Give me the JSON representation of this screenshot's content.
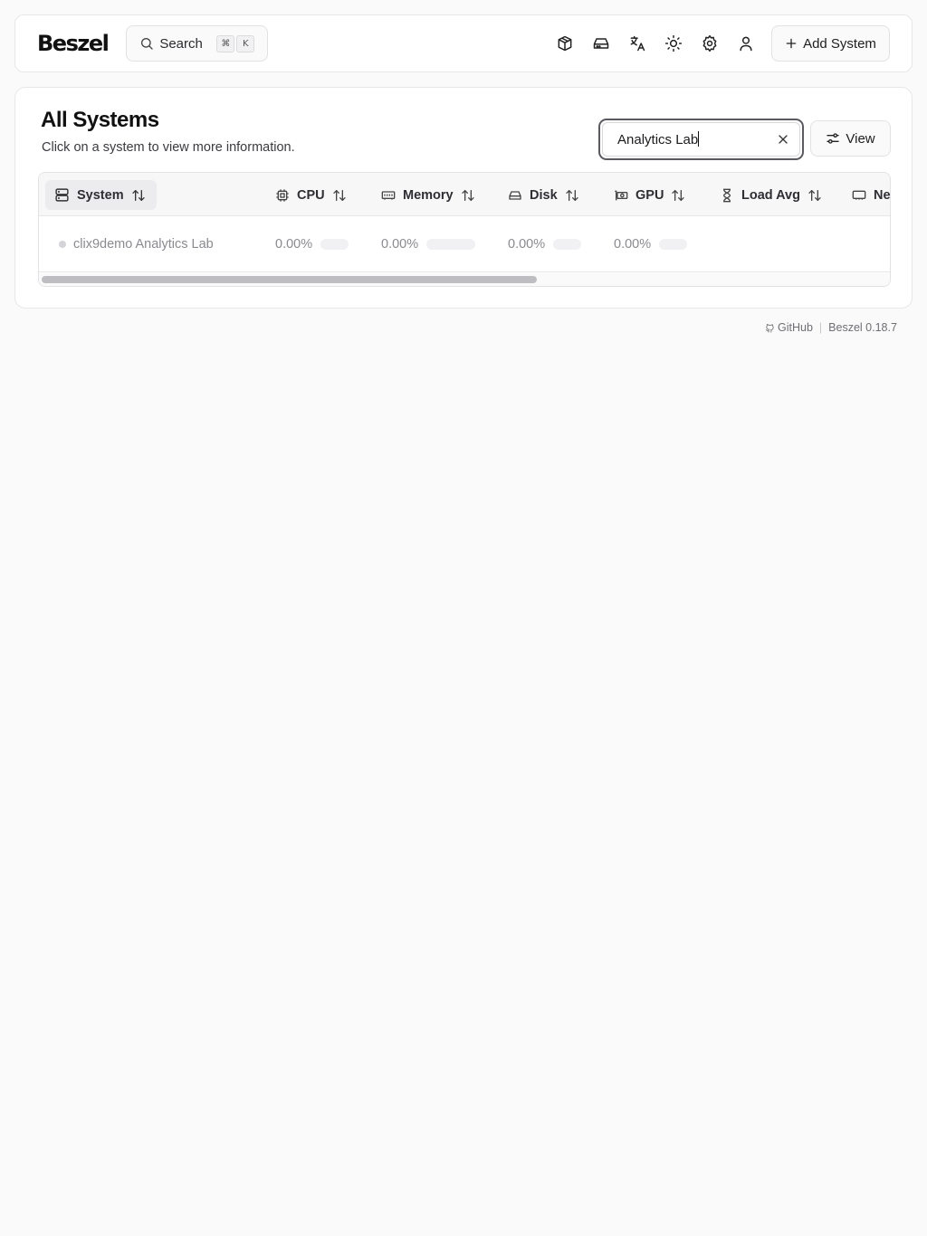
{
  "header": {
    "logo": "Beszel",
    "search_label": "Search",
    "search_shortcut": [
      "⌘",
      "K"
    ],
    "icons": [
      "containers-icon",
      "disks-icon",
      "language-icon",
      "theme-icon",
      "settings-icon",
      "user-icon"
    ],
    "add_system_label": "Add System"
  },
  "main": {
    "title": "All Systems",
    "subtitle": "Click on a system to view more information.",
    "filter_value": "Analytics Lab",
    "view_label": "View"
  },
  "table": {
    "columns": [
      {
        "label": "System",
        "icon": "server-icon"
      },
      {
        "label": "CPU",
        "icon": "cpu-icon"
      },
      {
        "label": "Memory",
        "icon": "memory-icon"
      },
      {
        "label": "Disk",
        "icon": "hard-drive-icon"
      },
      {
        "label": "GPU",
        "icon": "gpu-icon"
      },
      {
        "label": "Load Avg",
        "icon": "hourglass-icon"
      },
      {
        "label": "Ne",
        "icon": "network-icon"
      }
    ],
    "rows": [
      {
        "name": "clix9demo Analytics Lab",
        "status_color": "#d4d4d8",
        "cpu": "0.00%",
        "memory": "0.00%",
        "disk": "0.00%",
        "gpu": "0.00%"
      }
    ]
  },
  "footer": {
    "github": "GitHub",
    "version": "Beszel 0.18.7"
  }
}
